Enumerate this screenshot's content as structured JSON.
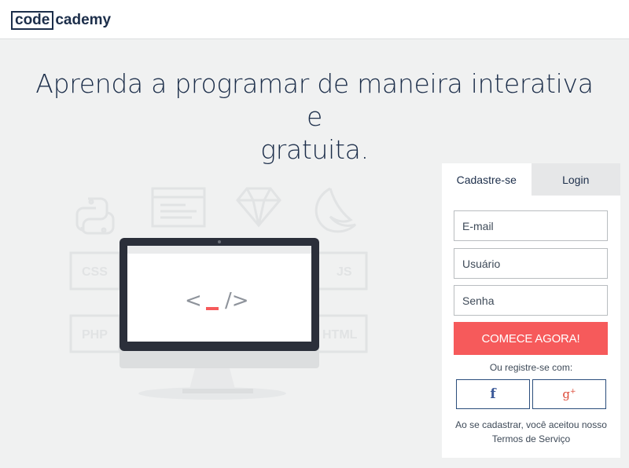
{
  "header": {
    "logo_box_text": "code",
    "logo_rest_text": "cademy"
  },
  "hero": {
    "headline_line1": "Aprenda a programar de maneira interativa e",
    "headline_line2": "gratuita."
  },
  "illustration": {
    "labels": [
      "CSS",
      "JS",
      "PHP",
      "HTML"
    ],
    "screen_code_left": "<",
    "screen_code_cursor": "_",
    "screen_code_right": "/>"
  },
  "signup": {
    "tabs": [
      {
        "label": "Cadastre-se",
        "active": true
      },
      {
        "label": "Login",
        "active": false
      }
    ],
    "email_placeholder": "E-mail",
    "username_placeholder": "Usuário",
    "password_placeholder": "Senha",
    "cta_label": "COMECE AGORA!",
    "or_text": "Ou registre-se com:",
    "social": [
      {
        "name": "facebook",
        "glyph": "f"
      },
      {
        "name": "google-plus",
        "glyph": "g",
        "sup": "+"
      }
    ],
    "terms_text": "Ao se cadastrar, você aceitou nosso",
    "terms_link": "Termos de Serviço"
  },
  "colors": {
    "page_bg": "#f0f1f1",
    "navy": "#1c2e4a",
    "accent": "#f65a5b",
    "social_border": "#2b4e7c"
  }
}
